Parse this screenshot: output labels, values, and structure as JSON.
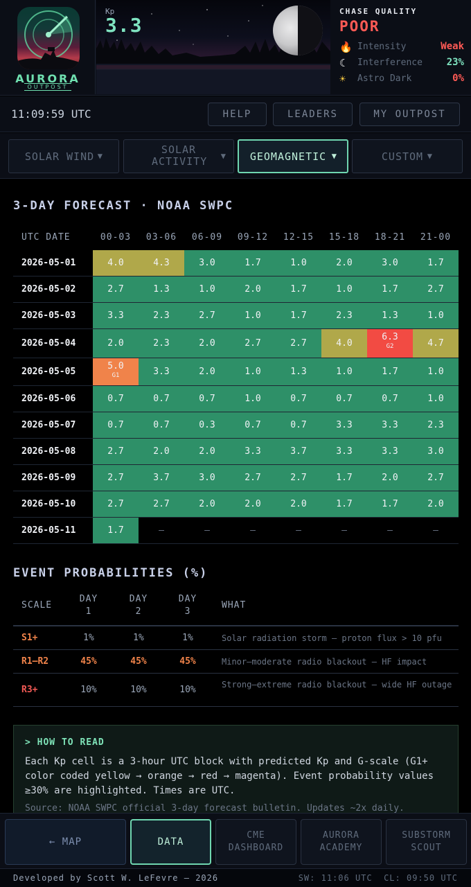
{
  "logo": {
    "name": "AURORA",
    "sub": "OUTPOST"
  },
  "kp": {
    "label": "Kp",
    "value": "3.3"
  },
  "chase": {
    "title": "CHASE QUALITY",
    "value": "POOR",
    "rows": [
      {
        "icon": "flame-icon",
        "label": "Intensity",
        "value": "Weak",
        "color": "#ff5a55"
      },
      {
        "icon": "moon-icon",
        "label": "Interference",
        "value": "23%",
        "color": "#7fe3c0"
      },
      {
        "icon": "sun-icon",
        "label": "Astro Dark",
        "value": "0%",
        "color": "#ff5a55"
      }
    ]
  },
  "clock": "11:09:59 UTC",
  "toolbar": {
    "help": "HELP",
    "leaders": "LEADERS",
    "my_outpost": "MY OUTPOST"
  },
  "categories": [
    {
      "label": "SOLAR WIND",
      "active": false
    },
    {
      "label": "SOLAR ACTIVITY",
      "active": false
    },
    {
      "label": "GEOMAGNETIC",
      "active": true
    },
    {
      "label": "CUSTOM",
      "active": false
    }
  ],
  "forecast": {
    "title": "3-DAY FORECAST · NOAA SWPC",
    "date_header": "UTC DATE",
    "columns": [
      "00-03",
      "03-06",
      "06-09",
      "09-12",
      "12-15",
      "15-18",
      "18-21",
      "21-00"
    ],
    "rows": [
      {
        "date": "2026-05-01",
        "values": [
          "4.0",
          "4.3",
          "3.0",
          "1.7",
          "1.0",
          "2.0",
          "3.0",
          "1.7"
        ]
      },
      {
        "date": "2026-05-02",
        "values": [
          "2.7",
          "1.3",
          "1.0",
          "2.0",
          "1.7",
          "1.0",
          "1.7",
          "2.7"
        ]
      },
      {
        "date": "2026-05-03",
        "values": [
          "3.3",
          "2.3",
          "2.7",
          "1.0",
          "1.7",
          "2.3",
          "1.3",
          "1.0"
        ]
      },
      {
        "date": "2026-05-04",
        "values": [
          "2.0",
          "2.3",
          "2.0",
          "2.7",
          "2.7",
          "4.0",
          "6.3",
          "4.7"
        ],
        "gscale": {
          "6": "G2"
        }
      },
      {
        "date": "2026-05-05",
        "values": [
          "5.0",
          "3.3",
          "2.0",
          "1.0",
          "1.3",
          "1.0",
          "1.7",
          "1.0"
        ],
        "gscale": {
          "0": "G1"
        }
      },
      {
        "date": "2026-05-06",
        "values": [
          "0.7",
          "0.7",
          "0.7",
          "1.0",
          "0.7",
          "0.7",
          "0.7",
          "1.0"
        ]
      },
      {
        "date": "2026-05-07",
        "values": [
          "0.7",
          "0.7",
          "0.3",
          "0.7",
          "0.7",
          "3.3",
          "3.3",
          "2.3"
        ]
      },
      {
        "date": "2026-05-08",
        "values": [
          "2.7",
          "2.0",
          "2.0",
          "3.3",
          "3.7",
          "3.3",
          "3.3",
          "3.0"
        ]
      },
      {
        "date": "2026-05-09",
        "values": [
          "2.7",
          "3.7",
          "3.0",
          "2.7",
          "2.7",
          "1.7",
          "2.0",
          "2.7"
        ]
      },
      {
        "date": "2026-05-10",
        "values": [
          "2.7",
          "2.7",
          "2.0",
          "2.0",
          "2.0",
          "1.7",
          "1.7",
          "2.0"
        ]
      },
      {
        "date": "2026-05-11",
        "values": [
          "1.7",
          "–",
          "–",
          "–",
          "–",
          "–",
          "–",
          "–"
        ]
      }
    ],
    "colors": {
      "quiet": "#2e9068",
      "active": "#b0a84a",
      "g1": "#f0834a",
      "g2": "#f24b43"
    }
  },
  "probabilities": {
    "title": "EVENT PROBABILITIES (%)",
    "headers": {
      "scale": "SCALE",
      "day1": "DAY\n1",
      "day2": "DAY\n2",
      "day3": "DAY\n3",
      "what": "WHAT"
    },
    "rows": [
      {
        "scale": "S1+",
        "color": "#f0834a",
        "d1": "1%",
        "d2": "1%",
        "d3": "1%",
        "highlight": false,
        "what": "Solar radiation storm — proton flux > 10 pfu"
      },
      {
        "scale": "R1–R2",
        "color": "#f0834a",
        "d1": "45%",
        "d2": "45%",
        "d3": "45%",
        "highlight": true,
        "what": "Minor–moderate radio blackout — HF impact"
      },
      {
        "scale": "R3+",
        "color": "#f25a55",
        "d1": "10%",
        "d2": "10%",
        "d3": "10%",
        "highlight": false,
        "what": "Strong–extreme radio blackout — wide HF outage"
      }
    ]
  },
  "how_to_read": {
    "title": "> HOW TO READ",
    "body": "Each Kp cell is a 3-hour UTC block with predicted Kp and G-scale (G1+ color coded yellow → orange → red → magenta). Event probability values ≥30% are highlighted. Times are UTC.",
    "source": "Source: NOAA SWPC official 3-day forecast bulletin. Updates ~2x daily."
  },
  "nav": {
    "map": "← MAP",
    "data": "DATA",
    "cme": "CME\nDASHBOARD",
    "academy": "AURORA\nACADEMY",
    "scout": "SUBSTORM\nSCOUT"
  },
  "footer": {
    "credit": "Developed by Scott W. LeFevre — 2026",
    "status": "SW: 11:06 UTC  CL: 09:50 UTC"
  }
}
